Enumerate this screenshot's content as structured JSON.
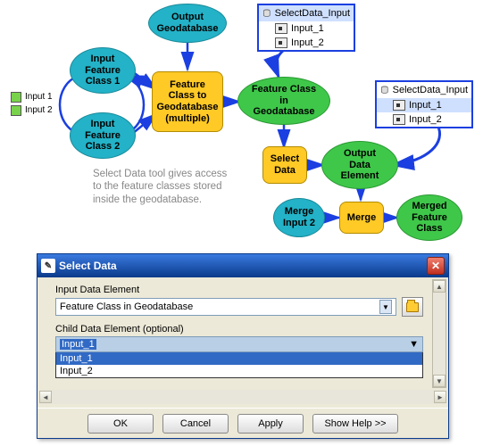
{
  "diagram": {
    "nodes": {
      "output_gdb": "Output\nGeodatabase",
      "in_fc1": "Input\nFeature\nClass 1",
      "in_fc2": "Input\nFeature\nClass 2",
      "fc_to_gdb": "Feature\nClass to\nGeodatabase\n(multiple)",
      "fc_in_gdb": "Feature Class\nin\nGeodatabase",
      "select_data": "Select\nData",
      "out_elem": "Output\nData\nElement",
      "merge_in2": "Merge\nInput 2",
      "merge": "Merge",
      "merged_fc": "Merged\nFeature\nClass"
    },
    "ports": {
      "p1": "Input 1",
      "p2": "Input 2"
    },
    "annotation": "Select Data tool gives access\nto the feature classes stored\ninside the geodatabase.",
    "tree1": {
      "root": "SelectData_Input",
      "items": [
        "Input_1",
        "Input_2"
      ]
    },
    "tree2": {
      "root": "SelectData_Input",
      "items": [
        "Input_1",
        "Input_2"
      ]
    }
  },
  "dialog": {
    "title": "Select Data",
    "label_input": "Input Data Element",
    "input_value": "Feature Class in Geodatabase",
    "label_child": "Child Data Element (optional)",
    "child_value": "Input_1",
    "options": [
      "Input_1",
      "Input_2"
    ],
    "buttons": {
      "ok": "OK",
      "cancel": "Cancel",
      "apply": "Apply",
      "help": "Show Help >>"
    }
  }
}
